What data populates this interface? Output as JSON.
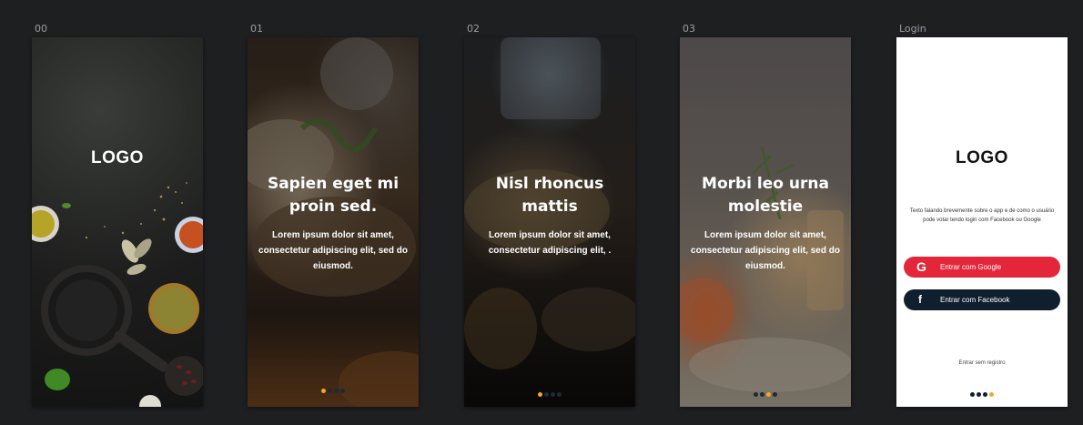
{
  "frames": [
    {
      "label": "00",
      "logo": "LOGO"
    },
    {
      "label": "01",
      "title": "Sapien eget mi proin sed.",
      "body": "Lorem ipsum dolor sit amet, consectetur adipiscing elit, sed do eiusmod."
    },
    {
      "label": "02",
      "title": "Nisl rhoncus mattis",
      "body": "Lorem ipsum dolor sit amet, consectetur adipiscing elit, ."
    },
    {
      "label": "03",
      "title": "Morbi leo urna molestie",
      "body": "Lorem ipsum dolor sit amet, consectetur adipiscing elit, sed do eiusmod."
    },
    {
      "label": "Login",
      "logo": "LOGO",
      "description": "Texto falando brevemente sobre o app e de como o usuário pode votar tendo login com Facebook ou Google",
      "google_button": "Entrar com Google",
      "facebook_button": "Entrar com Facebook",
      "skip_link": "Entrar sem registro"
    }
  ],
  "pagination": {
    "active_color": "#f5a623",
    "inactive_color": "#1c2a3a",
    "frame_01_active": 0,
    "frame_02_active": 1,
    "frame_03_active": 2,
    "login_active": 3
  },
  "colors": {
    "google": "#e3263a",
    "facebook": "#0f1f2e",
    "canvas": "#1e1f21"
  },
  "icons": {
    "google": "google-icon",
    "facebook": "facebook-icon"
  }
}
